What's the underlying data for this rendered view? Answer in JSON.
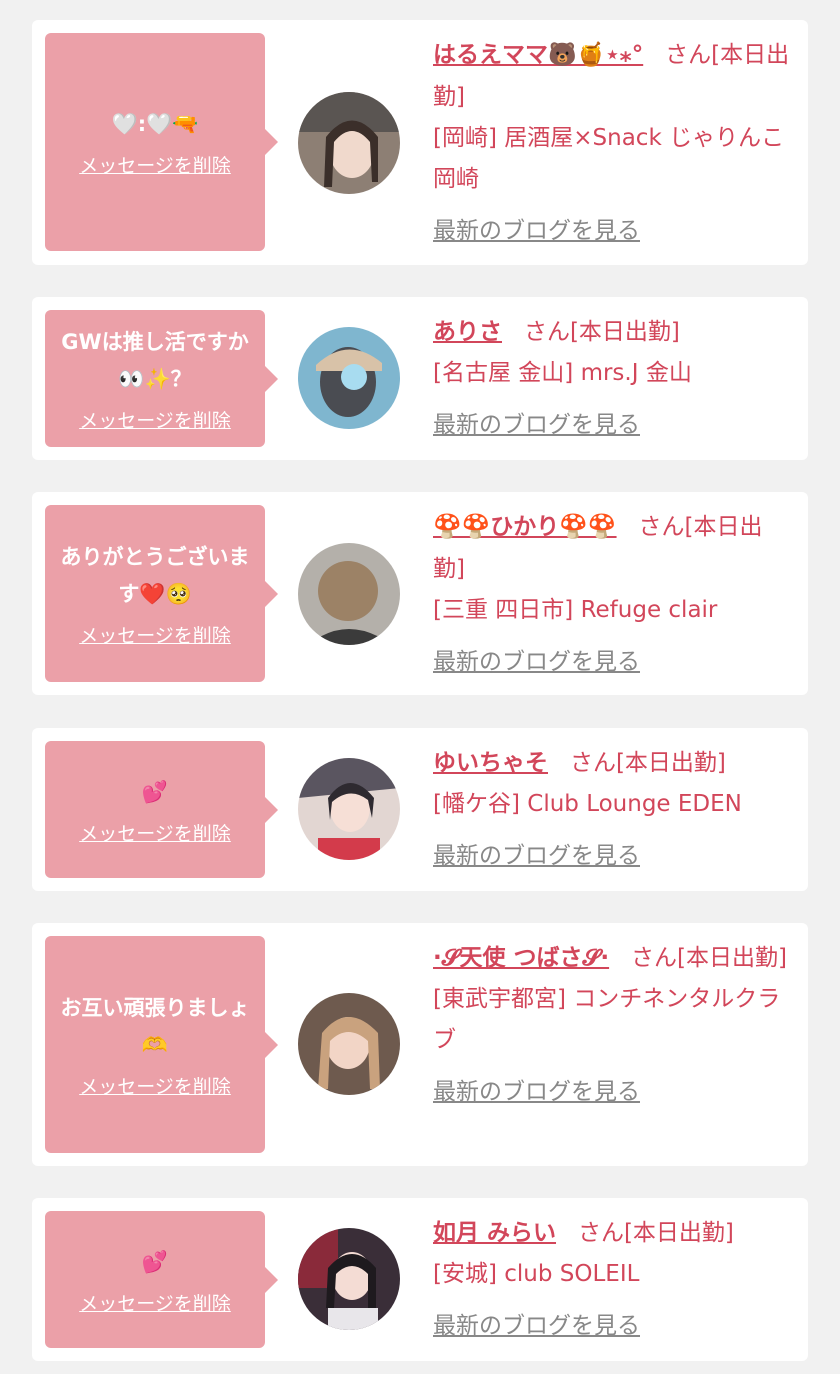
{
  "delete_label": "メッセージを削除",
  "blog_label": "最新のブログを見る",
  "san_label": "さん[本日出勤]",
  "items": [
    {
      "message": "🤍:🤍🔫",
      "name": "はるえママ🐻🍯⋆⁎°",
      "shop": "[岡崎] 居酒屋×Snack じゃりんこ岡崎"
    },
    {
      "message": "GWは推し活ですか👀✨？",
      "name": "ありさ",
      "shop": "[名古屋 金山] mrs.J 金山"
    },
    {
      "message": "ありがとうございます❤️🥺",
      "name": "🍄🍄ひかり🍄🍄",
      "shop": "[三重 四日市] Refuge clair"
    },
    {
      "message": "💕",
      "name": "ゆいちゃそ",
      "shop": "[幡ケ谷] Club Lounge EDEN"
    },
    {
      "message": "お互い頑張りましょ🫶",
      "name": "·𝓢天使 つばさ𝓢·",
      "shop": "[東武宇都宮] コンチネンタルクラブ"
    },
    {
      "message": "💕",
      "name": "如月 みらい",
      "shop": "[安城] club SOLEIL"
    }
  ]
}
